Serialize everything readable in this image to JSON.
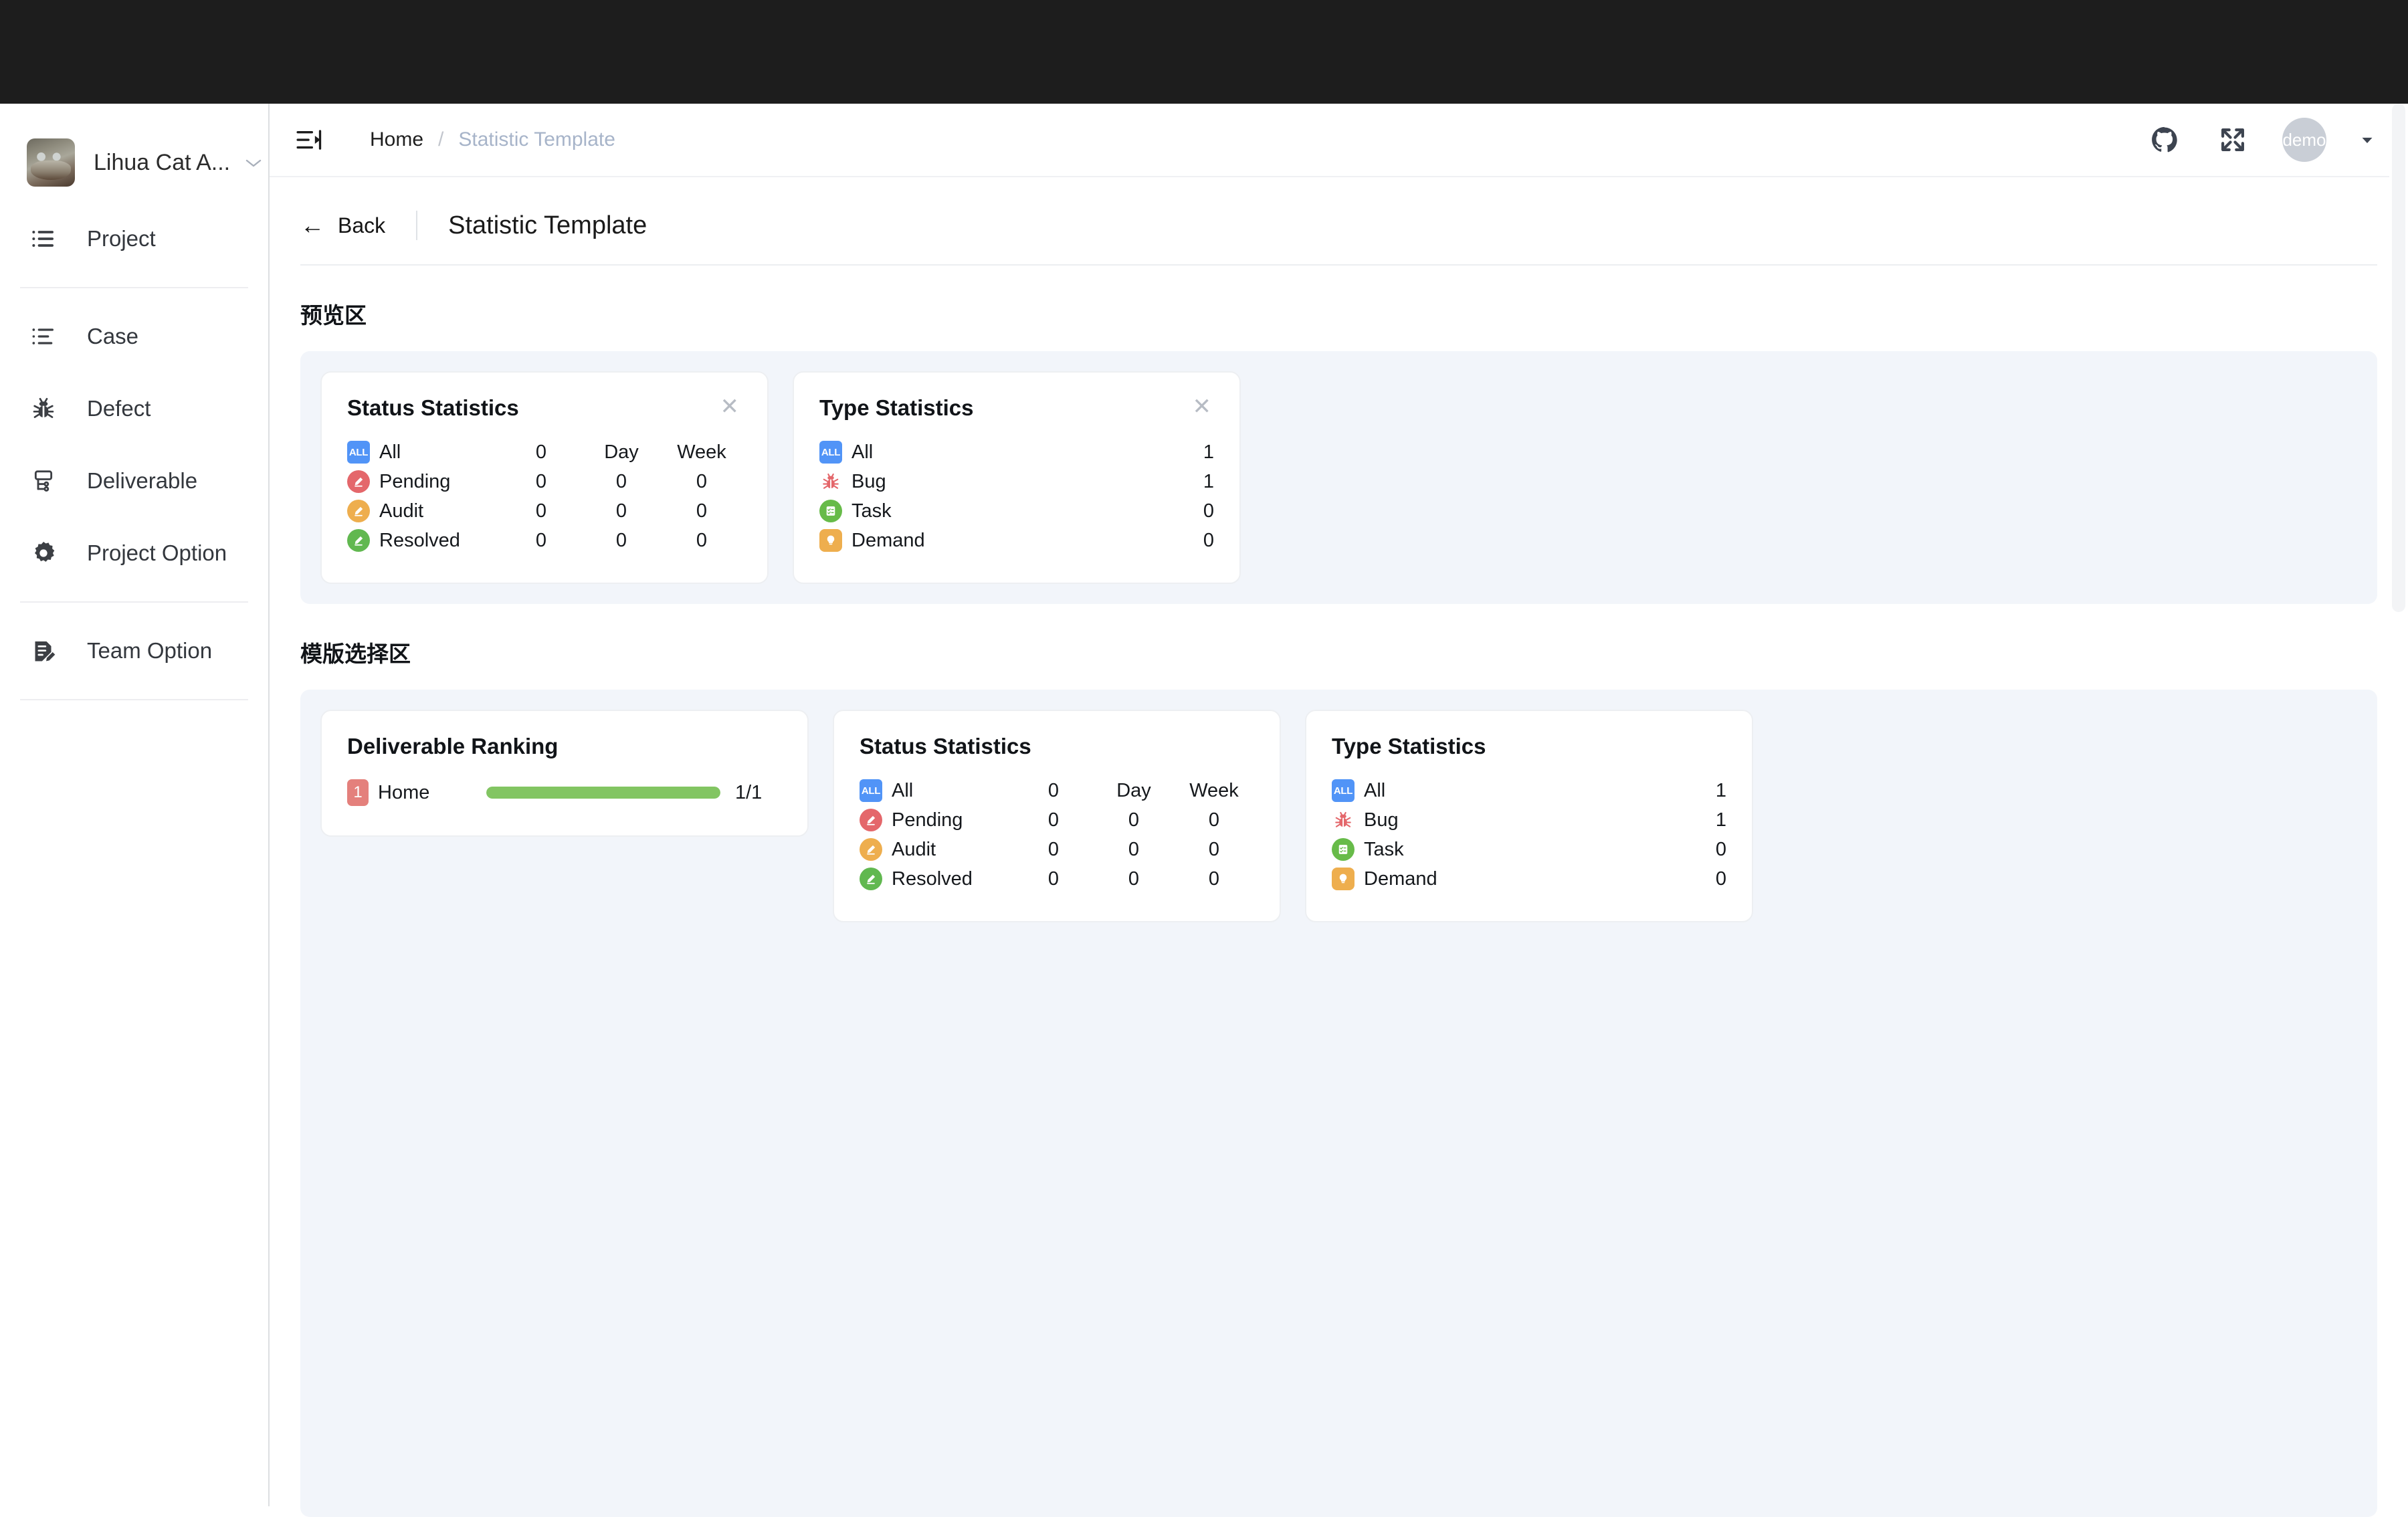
{
  "sidebar": {
    "team": {
      "name": "Lihua Cat A...",
      "avatar_icon": "cat-avatar",
      "caret_icon": "chevron-down-icon"
    },
    "items": [
      {
        "label": "Project",
        "icon": "list-icon"
      },
      {
        "label": "Case",
        "icon": "ordered-list-icon"
      },
      {
        "label": "Defect",
        "icon": "bug-icon"
      },
      {
        "label": "Deliverable",
        "icon": "deliverable-icon"
      },
      {
        "label": "Project Option",
        "icon": "gear-icon"
      },
      {
        "label": "Team Option",
        "icon": "document-edit-icon"
      }
    ]
  },
  "topbar": {
    "collapse_icon": "menu-collapse-icon",
    "breadcrumb": {
      "home": "Home",
      "separator": "/",
      "current": "Statistic Template"
    },
    "github_icon": "github-icon",
    "fullscreen_icon": "fullscreen-icon",
    "user": {
      "name": "demo",
      "caret_icon": "caret-down-icon"
    }
  },
  "page": {
    "back_label": "Back",
    "back_icon": "arrow-left-icon",
    "title": "Statistic Template",
    "preview_section_title": "预览区",
    "template_section_title": "模版选择区"
  },
  "preview_cards": [
    {
      "title": "Status Statistics",
      "close_icon": "close-icon",
      "columns": [
        "",
        "Day",
        "Week"
      ],
      "rows": [
        {
          "icon": "all-badge-icon",
          "label": "All",
          "values": [
            "0",
            "Day",
            "Week"
          ]
        },
        {
          "icon": "pending-icon",
          "label": "Pending",
          "values": [
            "0",
            "0",
            "0"
          ]
        },
        {
          "icon": "audit-icon",
          "label": "Audit",
          "values": [
            "0",
            "0",
            "0"
          ]
        },
        {
          "icon": "resolved-icon",
          "label": "Resolved",
          "values": [
            "0",
            "0",
            "0"
          ]
        }
      ]
    },
    {
      "title": "Type Statistics",
      "close_icon": "close-icon",
      "rows": [
        {
          "icon": "all-badge-icon",
          "label": "All",
          "value": "1"
        },
        {
          "icon": "bug-icon",
          "label": "Bug",
          "value": "1"
        },
        {
          "icon": "task-icon",
          "label": "Task",
          "value": "0"
        },
        {
          "icon": "demand-icon",
          "label": "Demand",
          "value": "0"
        }
      ]
    }
  ],
  "template_cards": {
    "deliverable_ranking": {
      "title": "Deliverable Ranking",
      "rows": [
        {
          "rank": "1",
          "name": "Home",
          "percent": 100,
          "value": "1/1"
        }
      ]
    },
    "status_statistics": {
      "title": "Status Statistics",
      "rows": [
        {
          "icon": "all-badge-icon",
          "label": "All",
          "values": [
            "0",
            "Day",
            "Week"
          ]
        },
        {
          "icon": "pending-icon",
          "label": "Pending",
          "values": [
            "0",
            "0",
            "0"
          ]
        },
        {
          "icon": "audit-icon",
          "label": "Audit",
          "values": [
            "0",
            "0",
            "0"
          ]
        },
        {
          "icon": "resolved-icon",
          "label": "Resolved",
          "values": [
            "0",
            "0",
            "0"
          ]
        }
      ]
    },
    "type_statistics": {
      "title": "Type Statistics",
      "rows": [
        {
          "icon": "all-badge-icon",
          "label": "All",
          "value": "1"
        },
        {
          "icon": "bug-icon",
          "label": "Bug",
          "value": "1"
        },
        {
          "icon": "task-icon",
          "label": "Task",
          "value": "0"
        },
        {
          "icon": "demand-icon",
          "label": "Demand",
          "value": "0"
        }
      ]
    }
  },
  "colors": {
    "accent_blue": "#5194f7",
    "pending_red": "#e4676b",
    "audit_orange": "#eeae4e",
    "resolved_green": "#61b850",
    "task_green": "#67bb49",
    "bug_red": "#e4676b",
    "progress_green": "#82c562",
    "rank_badge_red": "#e4807c",
    "panel_bg": "#f2f5fa",
    "chrome_black": "#1d1d1d"
  },
  "labels": {
    "all_badge_text": "ALL"
  }
}
